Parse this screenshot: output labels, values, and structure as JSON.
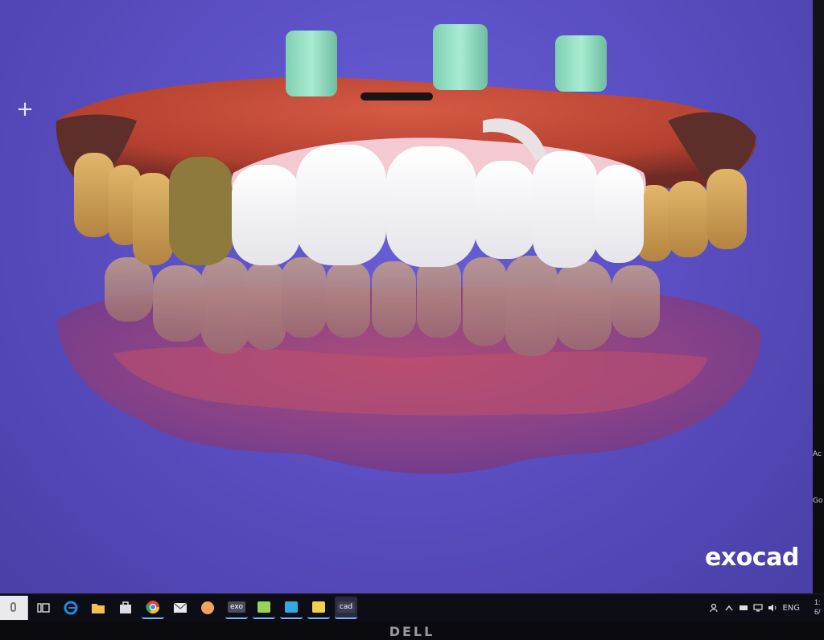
{
  "app": {
    "brand_label": "exocad",
    "cursor_glyph": "+",
    "edge_clip_text": [
      "Ac",
      "Go"
    ]
  },
  "scene": {
    "description_icon": "dental-3d-model-icon",
    "background_color": "#5b4fc4",
    "implant_color": "#8fdcc0",
    "crown_color": "#f5f5f7",
    "gingiva_color": "#c2483a",
    "tooth_color": "#c9a05a"
  },
  "taskbar": {
    "icons": [
      {
        "name": "edge-browser-icon",
        "label": "",
        "color": "#1e88e5",
        "running": false
      },
      {
        "name": "file-explorer-icon",
        "label": "",
        "color": "#f2c14e",
        "running": false
      },
      {
        "name": "store-icon",
        "label": "",
        "color": "#dcdce6",
        "running": false
      },
      {
        "name": "chrome-icon",
        "label": "",
        "color": "#e0453a",
        "running": true
      },
      {
        "name": "mail-icon",
        "label": "",
        "color": "#e9e9f0",
        "running": false
      },
      {
        "name": "orange-app-icon",
        "label": "",
        "color": "#f2a35e",
        "running": false
      },
      {
        "name": "exocad-exo-icon",
        "label": "exo",
        "color": "#4a4a60",
        "running": true
      },
      {
        "name": "green-app-icon",
        "label": "",
        "color": "#9bd35a",
        "running": true
      },
      {
        "name": "blue-app-icon",
        "label": "",
        "color": "#34a8e0",
        "running": true
      },
      {
        "name": "yellow-app-icon",
        "label": "",
        "color": "#f2d14e",
        "running": true
      },
      {
        "name": "exocad-cad-icon",
        "label": "cad",
        "color": "#3a3c55",
        "running": true
      }
    ],
    "tray": {
      "language": "ENG",
      "clock_time": "1:",
      "clock_date": "6/"
    }
  },
  "monitor": {
    "brand": "DELL"
  }
}
